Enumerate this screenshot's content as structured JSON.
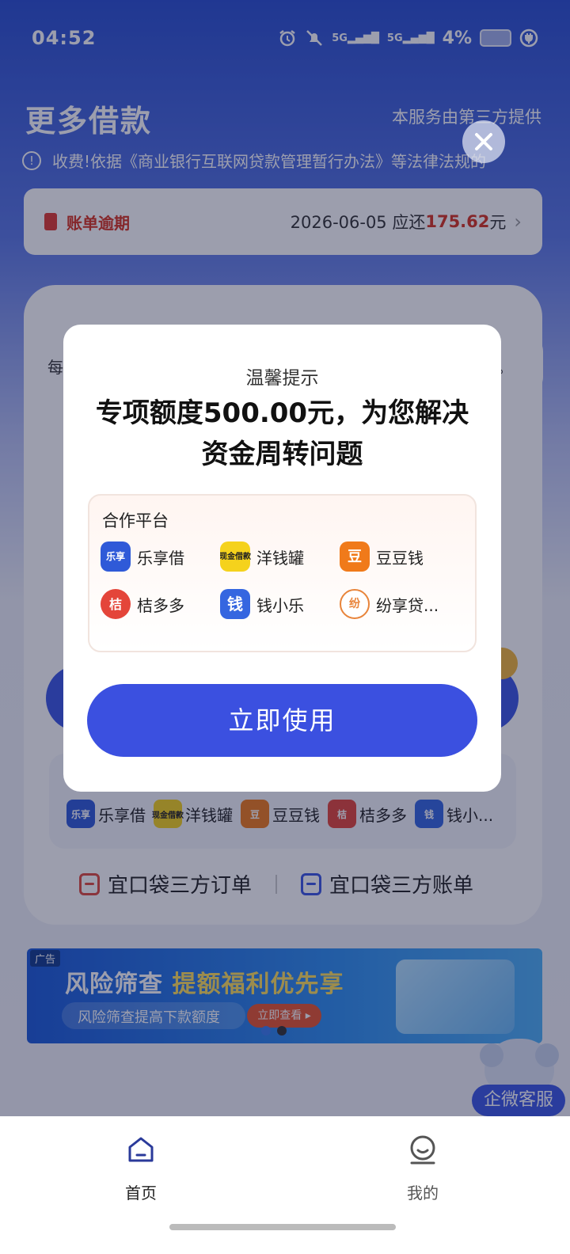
{
  "status_bar": {
    "time": "04:52",
    "net1": "5G",
    "net2": "5G",
    "battery": "4%"
  },
  "header": {
    "title": "更多借款",
    "subtitle": "本服务由第三方提供",
    "notice": "收费!依据《商业银行互联网贷款管理暂行办法》等法律法规的"
  },
  "bill": {
    "label": "账单逾期",
    "date": "2026-06-05 应还",
    "amount": "175.62",
    "unit": "元"
  },
  "main_card": {
    "prefix": "每",
    "suffix": "。"
  },
  "background_platforms": [
    {
      "name": "乐享借",
      "logo": "乐享",
      "color": "#2f5ad8"
    },
    {
      "name": "洋钱罐",
      "logo": "现金借款",
      "color": "#f5d21c"
    },
    {
      "name": "豆豆钱",
      "logo": "豆",
      "color": "#f07a1a"
    },
    {
      "name": "桔多多",
      "logo": "桔",
      "color": "#e4453a"
    },
    {
      "name": "钱小...",
      "logo": "钱",
      "color": "#3566e0"
    }
  ],
  "orders": {
    "left": "宜口袋三方订单",
    "right": "宜口袋三方账单",
    "left_color": "#e04a3f",
    "right_color": "#3b57e4"
  },
  "ad": {
    "tag": "广告",
    "title_a": "风险筛查",
    "title_b": "提额福利优先享",
    "subtitle": "风险筛查提高下款额度",
    "button": "立即查看 ▸"
  },
  "service": {
    "label": "企微客服"
  },
  "tabbar": {
    "home": "首页",
    "mine": "我的"
  },
  "modal": {
    "hint": "温馨提示",
    "title": "专项额度500.00元，为您解决资金周转问题",
    "partners_header": "合作平台",
    "partners": [
      {
        "name": "乐享借",
        "logo": "乐享",
        "color": "#2f5ad8"
      },
      {
        "name": "洋钱罐",
        "logo": "现金借款",
        "color": "#f5d21c"
      },
      {
        "name": "豆豆钱",
        "logo": "豆",
        "color": "#f07a1a"
      },
      {
        "name": "桔多多",
        "logo": "桔",
        "color": "#e4453a"
      },
      {
        "name": "钱小乐",
        "logo": "钱",
        "color": "#3566e0"
      },
      {
        "name": "纷享贷...",
        "logo": "纷",
        "color": "#e8843a"
      }
    ],
    "button": "立即使用"
  },
  "colors": {
    "primary": "#3b50e0",
    "danger": "#d8331f"
  }
}
